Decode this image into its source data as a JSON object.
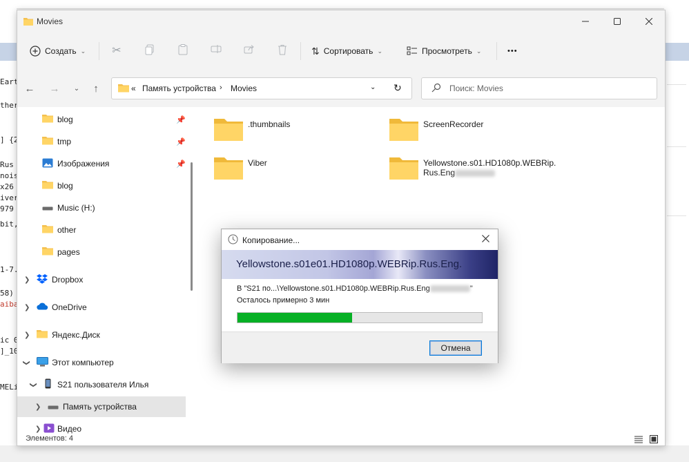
{
  "background": {
    "left_fragments": [
      "Eart",
      "ther",
      "] {2",
      "Rus",
      "nois",
      " x26",
      "iver",
      "979",
      "bit,",
      "1-7.",
      "58)",
      "aiba",
      "ic 0",
      "]_10",
      "MELi"
    ]
  },
  "window": {
    "title": "Movies",
    "minimize_icon": "minimize-icon",
    "maximize_icon": "maximize-icon",
    "close_icon": "close-icon"
  },
  "commandbar": {
    "new_label": "Создать",
    "sort_label": "Сортировать",
    "view_label": "Просмотреть",
    "more_label": "•••"
  },
  "address": {
    "overflow": "«",
    "crumbs": [
      "Память устройства",
      "Movies"
    ],
    "search_placeholder": "Поиск: Movies"
  },
  "navpane": {
    "items": [
      {
        "label": "blog",
        "icon": "folder-icon",
        "pinned": true
      },
      {
        "label": "tmp",
        "icon": "folder-icon",
        "pinned": true
      },
      {
        "label": "Изображения",
        "icon": "pictures-icon",
        "pinned": true
      },
      {
        "label": "blog",
        "icon": "folder-icon",
        "pinned": false
      },
      {
        "label": "Music (H:)",
        "icon": "drive-icon",
        "pinned": false
      },
      {
        "label": "other",
        "icon": "folder-icon",
        "pinned": false
      },
      {
        "label": "pages",
        "icon": "folder-icon",
        "pinned": false
      },
      {
        "label": "Dropbox",
        "icon": "dropbox-icon",
        "pinned": false
      },
      {
        "label": "OneDrive",
        "icon": "onedrive-icon",
        "pinned": false
      },
      {
        "label": "Яндекс.Диск",
        "icon": "folder-icon",
        "pinned": false
      },
      {
        "label": "Этот компьютер",
        "icon": "computer-icon",
        "pinned": false
      },
      {
        "label": "S21 пользователя Илья",
        "icon": "phone-icon",
        "pinned": false
      },
      {
        "label": "Память устройства",
        "icon": "drive-icon",
        "pinned": false
      },
      {
        "label": "Видео",
        "icon": "video-icon",
        "pinned": false
      }
    ]
  },
  "files": [
    {
      "name": ".thumbnails"
    },
    {
      "name": "ScreenRecorder"
    },
    {
      "name": "Viber"
    },
    {
      "name_line1": "Yellowstone.s01.HD1080p.WEBRip.",
      "name_line2": "Rus.Eng"
    }
  ],
  "status": {
    "items_count": "Элементов: 4"
  },
  "dialog": {
    "title": "Копирование...",
    "banner": "Yellowstone.s01e01.HD1080p.WEBRip.Rus.Eng.",
    "line1": "В \"S21 по...\\Yellowstone.s01.HD1080p.WEBRip.Rus.Eng",
    "line1_end": "\"",
    "line2": "Осталось примерно 3 мин",
    "progress": 0.47,
    "cancel_label": "Отмена"
  },
  "colors": {
    "progress_fill": "#06b025",
    "folder": "#f4c04e",
    "accent": "#0078d7"
  }
}
